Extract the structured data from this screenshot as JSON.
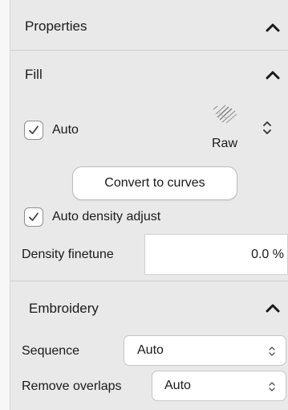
{
  "properties": {
    "title": "Properties"
  },
  "fill": {
    "title": "Fill",
    "auto_label": "Auto",
    "auto_checked": true,
    "raw_label": "Raw",
    "convert_button": "Convert to curves",
    "auto_density_label": "Auto density adjust",
    "auto_density_checked": true,
    "density_finetune_label": "Density finetune",
    "density_finetune_value": "0.0 %"
  },
  "embroidery": {
    "title": "Embroidery",
    "sequence_label": "Sequence",
    "sequence_value": "Auto",
    "remove_overlaps_label": "Remove overlaps",
    "remove_overlaps_value": "Auto"
  }
}
